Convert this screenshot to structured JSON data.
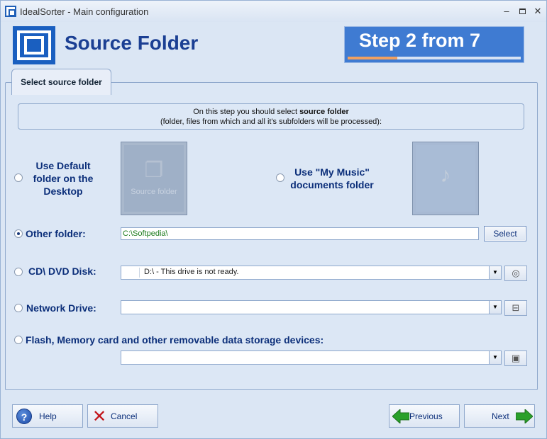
{
  "window": {
    "title": "IdealSorter - Main configuration",
    "min": "–",
    "max": "",
    "close": "✕"
  },
  "header": {
    "title": "Source Folder",
    "step_text": "Step 2 from 7",
    "step_progress": 0.2857
  },
  "tab": {
    "label": "Select source folder"
  },
  "info": {
    "line1_prefix": "On this step you should select ",
    "line1_bold": "source folder",
    "line2": "(folder, files from which and all it's subfolders will be processed):"
  },
  "options": {
    "default_desktop": {
      "label": "Use Default folder on the Desktop",
      "tile_caption": "Source folder"
    },
    "my_music": {
      "label": "Use \"My Music\" documents folder"
    },
    "other_folder": {
      "label": "Other folder:",
      "value": "C:\\Softpedia\\",
      "button": "Select"
    },
    "cd_dvd": {
      "label": "CD\\ DVD Disk:",
      "value": "D:\\ - This drive is not ready."
    },
    "network": {
      "label": "Network Drive:",
      "value": ""
    },
    "flash": {
      "label": "Flash, Memory card and other removable data storage devices:",
      "value": ""
    }
  },
  "buttons": {
    "help": "Help",
    "cancel": "Cancel",
    "previous": "Previous",
    "next": "Next"
  },
  "colors": {
    "accent": "#1a5fc0",
    "title": "#1b3f93",
    "arrow_green": "#2aa02a"
  },
  "icons": {
    "app": "app-icon",
    "help": "question-icon",
    "cancel": "x-icon",
    "previous": "left-arrow-icon",
    "next": "right-arrow-icon",
    "cd": "disc-icon",
    "network": "network-drive-icon",
    "flash": "removable-drive-icon"
  }
}
